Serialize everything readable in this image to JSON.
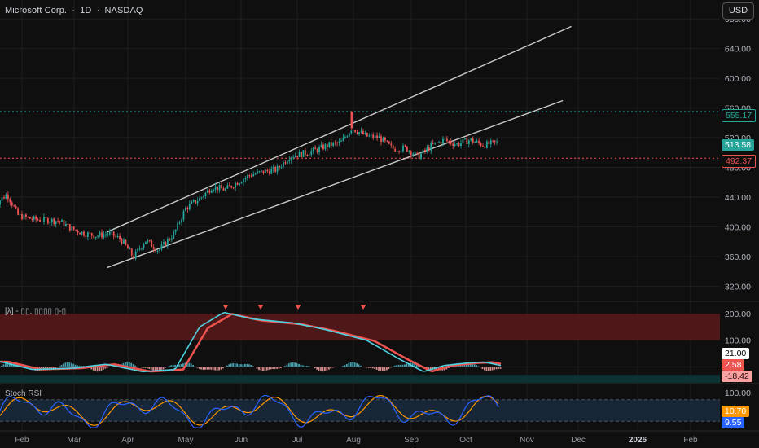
{
  "header": {
    "symbol_name": "Microsoft Corp.",
    "separator": "·",
    "interval": "1D",
    "separator2": "·",
    "exchange": "NASDAQ",
    "currency_button": "USD"
  },
  "indicators": {
    "macd_label": "[λ] - ▯▯. ▯▯▯▯ ▯-▯",
    "stoch_label": "Stoch RSI"
  },
  "price_tags": {
    "target": "555.17",
    "last": "513.58",
    "support": "492.37"
  },
  "macd_tags": {
    "a": "21.00",
    "b": "2.58",
    "c": "-18.42"
  },
  "stoch_tags": {
    "a": "10.70",
    "b": "9.55"
  },
  "chart_data": [
    {
      "type": "candlestick",
      "x_ticks": [
        "Feb",
        "Mar",
        "Apr",
        "May",
        "Jun",
        "Jul",
        "Aug",
        "Sep",
        "Oct",
        "Nov",
        "Dec",
        "2026",
        "Feb"
      ],
      "y_ticks": [
        320,
        360,
        400,
        440,
        480,
        520,
        560,
        600,
        640,
        680
      ],
      "y_tick_labels": [
        "320.00",
        "360.00",
        "400.00",
        "440.00",
        "480.00",
        "520.00",
        "560.00",
        "600.00",
        "640.00",
        "680.00"
      ],
      "ylim": [
        305,
        700
      ],
      "horizontal_levels": [
        {
          "value": 555.17,
          "color": "#26a69a",
          "style": "dotted"
        },
        {
          "value": 492.37,
          "color": "#ef5350",
          "style": "dotted"
        }
      ],
      "last_price": 513.58,
      "trendlines": [
        {
          "from": [
            "2025-03-20",
            393
          ],
          "to": [
            "2025-11-27",
            670
          ]
        },
        {
          "from": [
            "2025-03-20",
            345
          ],
          "to": [
            "2025-11-22",
            570
          ]
        }
      ],
      "closes": [
        {
          "date": "2025-01-17",
          "c": 429
        },
        {
          "date": "2025-01-24",
          "c": 444
        },
        {
          "date": "2025-01-30",
          "c": 415
        },
        {
          "date": "2025-02-07",
          "c": 410
        },
        {
          "date": "2025-02-14",
          "c": 409
        },
        {
          "date": "2025-02-21",
          "c": 408
        },
        {
          "date": "2025-02-28",
          "c": 397
        },
        {
          "date": "2025-03-07",
          "c": 391
        },
        {
          "date": "2025-03-14",
          "c": 388
        },
        {
          "date": "2025-03-21",
          "c": 391
        },
        {
          "date": "2025-03-28",
          "c": 383
        },
        {
          "date": "2025-04-04",
          "c": 359
        },
        {
          "date": "2025-04-10",
          "c": 382
        },
        {
          "date": "2025-04-17",
          "c": 368
        },
        {
          "date": "2025-04-25",
          "c": 391
        },
        {
          "date": "2025-05-01",
          "c": 425
        },
        {
          "date": "2025-05-09",
          "c": 438
        },
        {
          "date": "2025-05-16",
          "c": 454
        },
        {
          "date": "2025-05-23",
          "c": 450
        },
        {
          "date": "2025-05-30",
          "c": 460
        },
        {
          "date": "2025-06-06",
          "c": 470
        },
        {
          "date": "2025-06-13",
          "c": 474
        },
        {
          "date": "2025-06-20",
          "c": 477
        },
        {
          "date": "2025-06-27",
          "c": 495
        },
        {
          "date": "2025-07-03",
          "c": 498
        },
        {
          "date": "2025-07-11",
          "c": 503
        },
        {
          "date": "2025-07-18",
          "c": 510
        },
        {
          "date": "2025-07-25",
          "c": 513
        },
        {
          "date": "2025-07-31",
          "c": 533
        },
        {
          "date": "2025-08-08",
          "c": 522
        },
        {
          "date": "2025-08-15",
          "c": 520
        },
        {
          "date": "2025-08-22",
          "c": 505
        },
        {
          "date": "2025-08-29",
          "c": 506
        },
        {
          "date": "2025-09-05",
          "c": 495
        },
        {
          "date": "2025-09-12",
          "c": 509
        },
        {
          "date": "2025-09-19",
          "c": 517
        },
        {
          "date": "2025-09-26",
          "c": 511
        },
        {
          "date": "2025-10-03",
          "c": 517
        },
        {
          "date": "2025-10-10",
          "c": 510
        },
        {
          "date": "2025-10-17",
          "c": 513.58
        }
      ],
      "macd": {
        "ylim": [
          -60,
          240
        ],
        "y_ticks": [
          100,
          200
        ],
        "y_tick_labels": [
          "100.00",
          "200.00"
        ],
        "values": {
          "line": 21.0,
          "signal": 2.58,
          "histogram": -18.42
        }
      },
      "stoch_rsi": {
        "ylim": [
          0,
          100
        ],
        "y_ticks": [
          100
        ],
        "y_tick_labels": [
          "100.00"
        ],
        "values": {
          "k": 10.7,
          "d": 9.55
        }
      }
    }
  ]
}
